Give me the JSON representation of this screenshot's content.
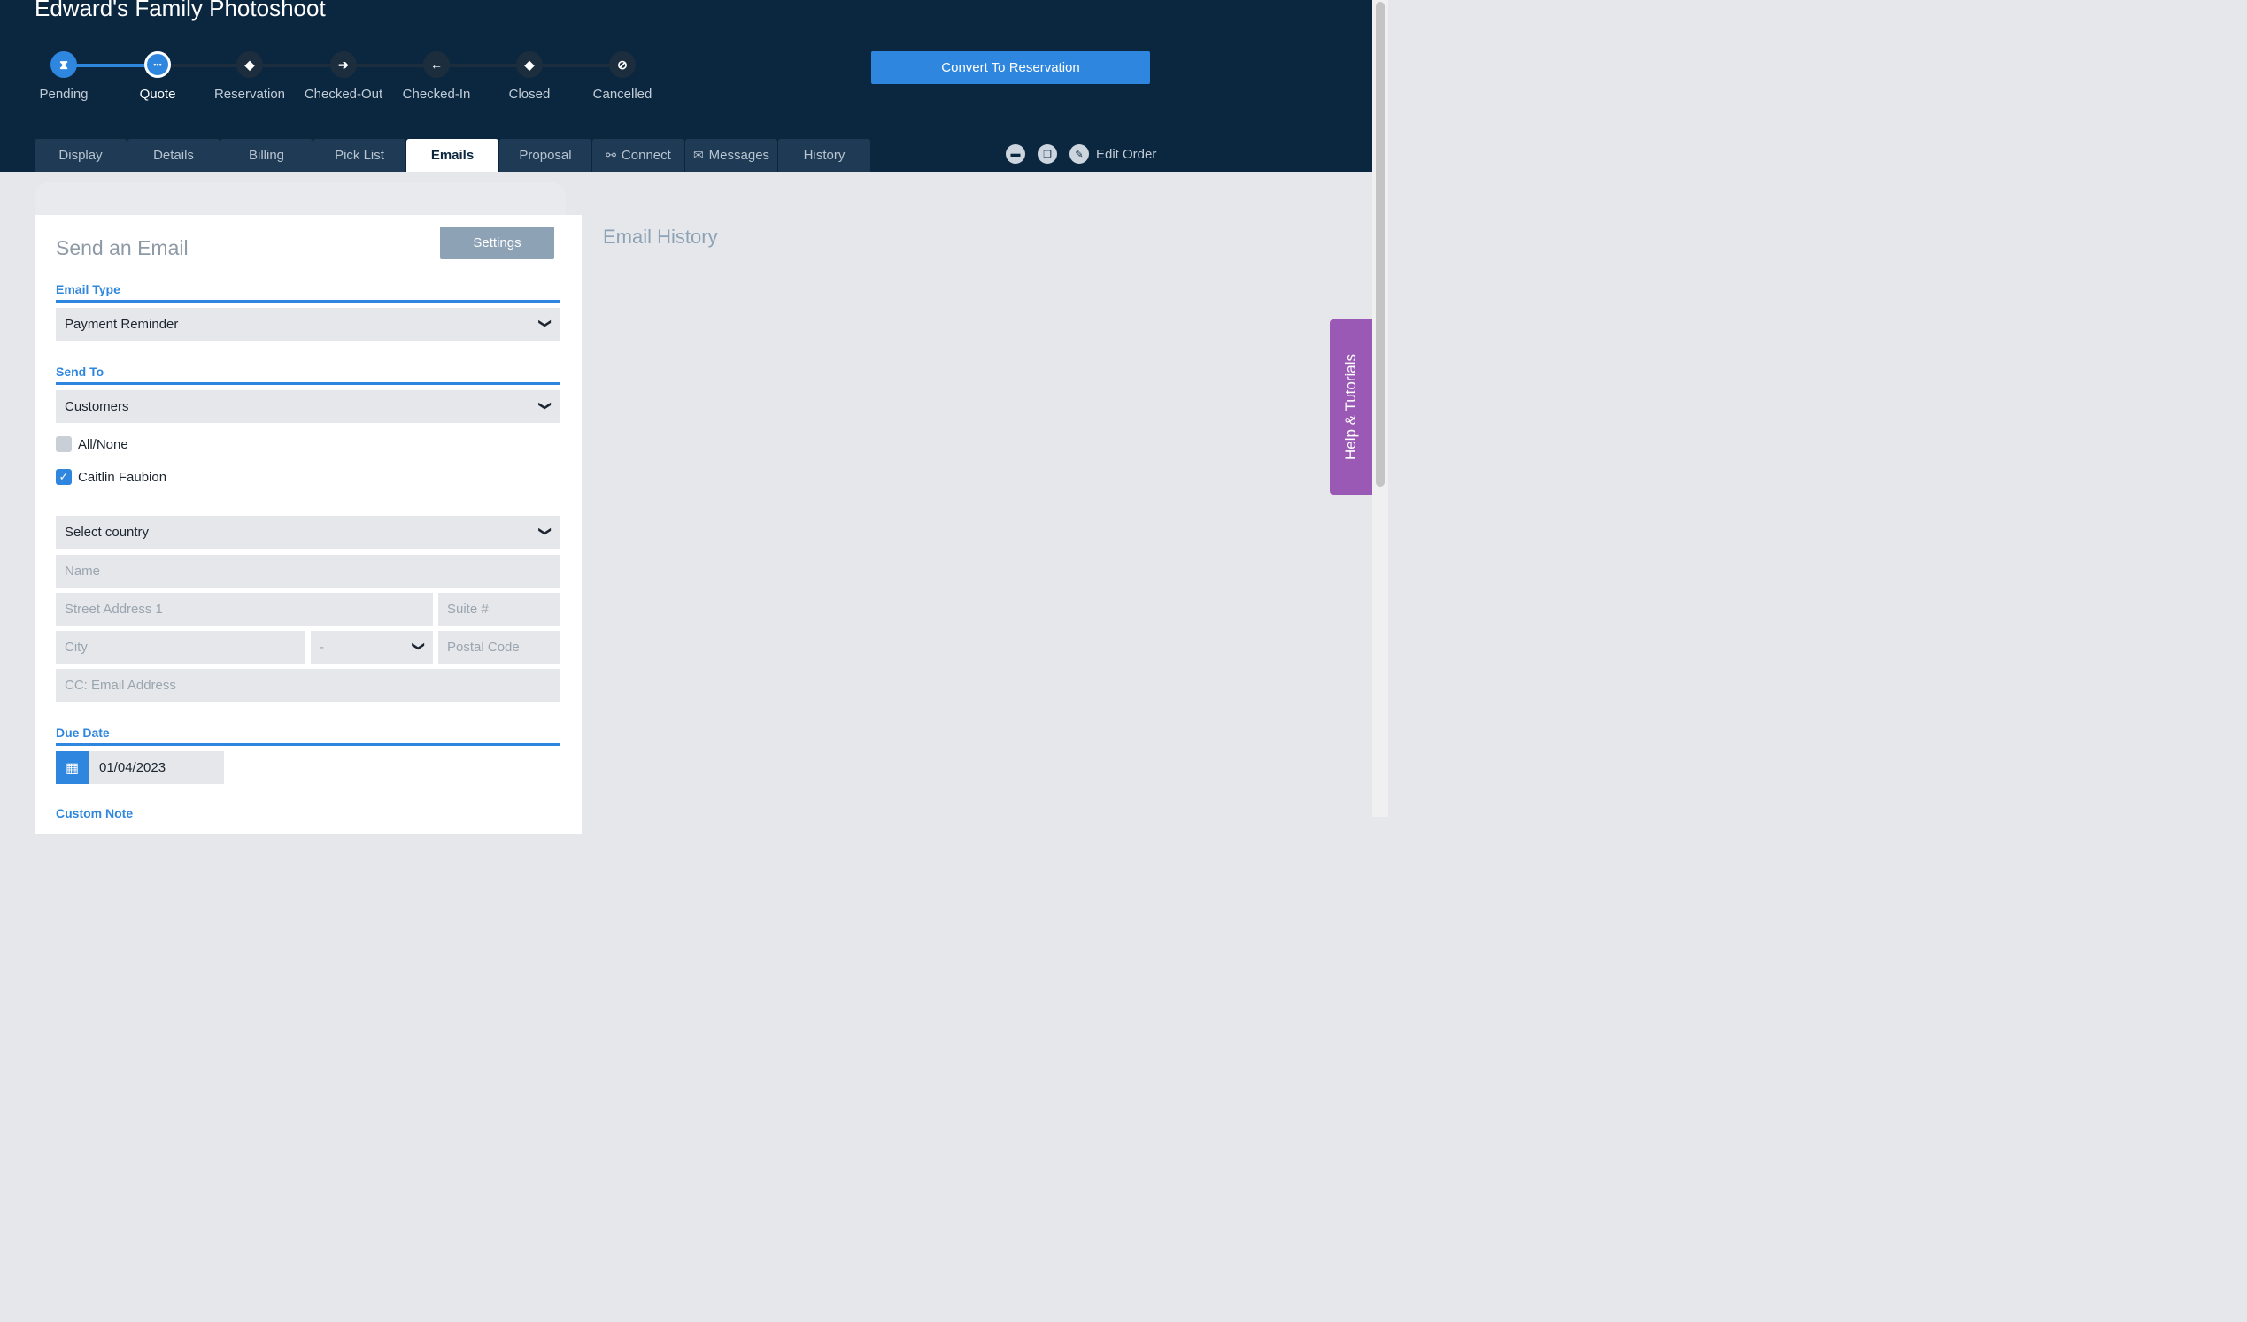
{
  "order": {
    "title": "Edward's Family Photoshoot"
  },
  "steps": [
    {
      "label": "Pending",
      "icon": "hourglass-icon",
      "glyph": "⧗",
      "state": "done"
    },
    {
      "label": "Quote",
      "icon": "ellipsis-icon",
      "glyph": "•••",
      "state": "current"
    },
    {
      "label": "Reservation",
      "icon": "tag-icon",
      "glyph": "◆",
      "state": "todo"
    },
    {
      "label": "Checked-Out",
      "icon": "arrow-right-icon",
      "glyph": "➔",
      "state": "todo"
    },
    {
      "label": "Checked-In",
      "icon": "arrow-left-icon",
      "glyph": "←",
      "state": "todo"
    },
    {
      "label": "Closed",
      "icon": "tag-check-icon",
      "glyph": "◆",
      "state": "todo"
    },
    {
      "label": "Cancelled",
      "icon": "cancel-icon",
      "glyph": "⊘",
      "state": "todo"
    }
  ],
  "header": {
    "convert_label": "Convert To Reservation",
    "edit_label": "Edit Order"
  },
  "tabs": [
    {
      "label": "Display",
      "active": false
    },
    {
      "label": "Details",
      "active": false
    },
    {
      "label": "Billing",
      "active": false
    },
    {
      "label": "Pick List",
      "active": false
    },
    {
      "label": "Emails",
      "active": true
    },
    {
      "label": "Proposal",
      "active": false
    },
    {
      "label": "Connect",
      "active": false,
      "icon": "connect-icon"
    },
    {
      "label": "Messages",
      "active": false,
      "icon": "inbox-icon"
    },
    {
      "label": "History",
      "active": false
    }
  ],
  "email": {
    "title": "Send an Email",
    "settings_label": "Settings",
    "email_type_label": "Email Type",
    "email_type_value": "Payment Reminder",
    "send_to_label": "Send To",
    "send_to_value": "Customers",
    "all_none_label": "All/None",
    "all_none_checked": false,
    "recipient_label": "Caitlin Faubion",
    "recipient_checked": true,
    "country_placeholder": "Select country",
    "name_placeholder": "Name",
    "street_placeholder": "Street Address 1",
    "suite_placeholder": "Suite #",
    "city_placeholder": "City",
    "state_value": "-",
    "postal_placeholder": "Postal Code",
    "cc_placeholder": "CC: Email Address",
    "due_date_label": "Due Date",
    "due_date_value": "01/04/2023",
    "custom_note_label": "Custom Note"
  },
  "history": {
    "title": "Email History"
  },
  "help": {
    "label": "Help & Tutorials"
  },
  "colors": {
    "header_bg": "#0b2740",
    "accent": "#2e86de",
    "help_tab": "#9b59b6"
  }
}
